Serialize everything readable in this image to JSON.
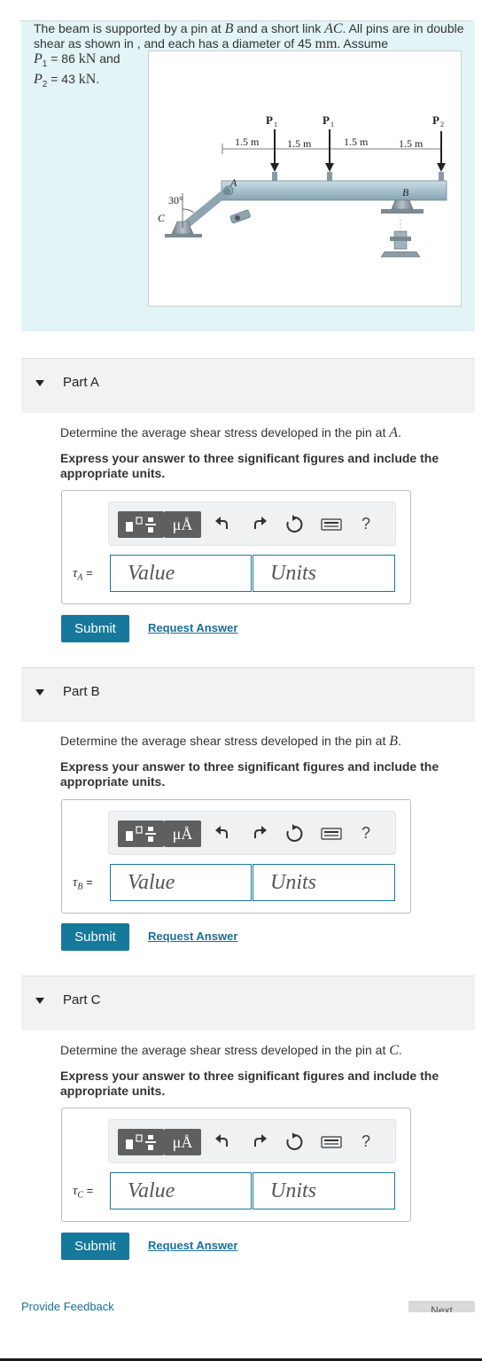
{
  "problem": {
    "text_1": "The beam is supported by a pin at ",
    "var_B": "B",
    "text_2": " and a short link ",
    "var_AC": "AC",
    "text_3": ". All pins are in double shear as shown in , and each has a diameter of 45 ",
    "unit_mm": "mm",
    "text_4": ". Assume",
    "p1_label": "P",
    "p1_sub": "1",
    "p1_eq": " = 86 ",
    "p1_unit": "kN",
    "p1_and": " and",
    "p2_label": "P",
    "p2_sub": "2",
    "p2_eq": " = 43 ",
    "p2_unit": "kN",
    "p2_end": "."
  },
  "figure": {
    "dims": [
      "1.5 m",
      "1.5 m",
      "1.5 m",
      "1.5 m"
    ],
    "load_p1": "P",
    "load_p1_sub": "1",
    "load_p2": "P",
    "load_p2_sub": "2",
    "angle": "30°",
    "label_a": "A",
    "label_b": "B",
    "label_c": "C"
  },
  "parts": [
    {
      "title": "Part A",
      "q_text": "Determine the average shear stress developed in the pin at ",
      "q_var": "A",
      "q_end": ".",
      "instruction": "Express your answer to three significant figures and include the appropriate units.",
      "tau_symbol": "τ",
      "tau_sub": "A",
      "eq": " =",
      "value_placeholder": "Value",
      "units_placeholder": "Units",
      "submit": "Submit",
      "request": "Request Answer"
    },
    {
      "title": "Part B",
      "q_text": "Determine the average shear stress developed in the pin at ",
      "q_var": "B",
      "q_end": ".",
      "instruction": "Express your answer to three significant figures and include the appropriate units.",
      "tau_symbol": "τ",
      "tau_sub": "B",
      "eq": " =",
      "value_placeholder": "Value",
      "units_placeholder": "Units",
      "submit": "Submit",
      "request": "Request Answer"
    },
    {
      "title": "Part C",
      "q_text": "Determine the average shear stress developed in the pin at ",
      "q_var": "C",
      "q_end": ".",
      "instruction": "Express your answer to three significant figures and include the appropriate units.",
      "tau_symbol": "τ",
      "tau_sub": "C",
      "eq": " =",
      "value_placeholder": "Value",
      "units_placeholder": "Units",
      "submit": "Submit",
      "request": "Request Answer"
    }
  ],
  "toolbar": {
    "mu_label": "μÅ",
    "help_label": "?",
    "icons": [
      "templates-icon",
      "symbols-icon",
      "undo-icon",
      "redo-icon",
      "reset-icon",
      "keyboard-icon",
      "help-icon"
    ]
  },
  "footer": {
    "feedback": "Provide Feedback",
    "next": "Next"
  },
  "colors": {
    "problem_bg": "#e3f4f6",
    "accent": "#16789a",
    "link": "#1a6f9c",
    "part_header_bg": "#f2f2f2"
  }
}
